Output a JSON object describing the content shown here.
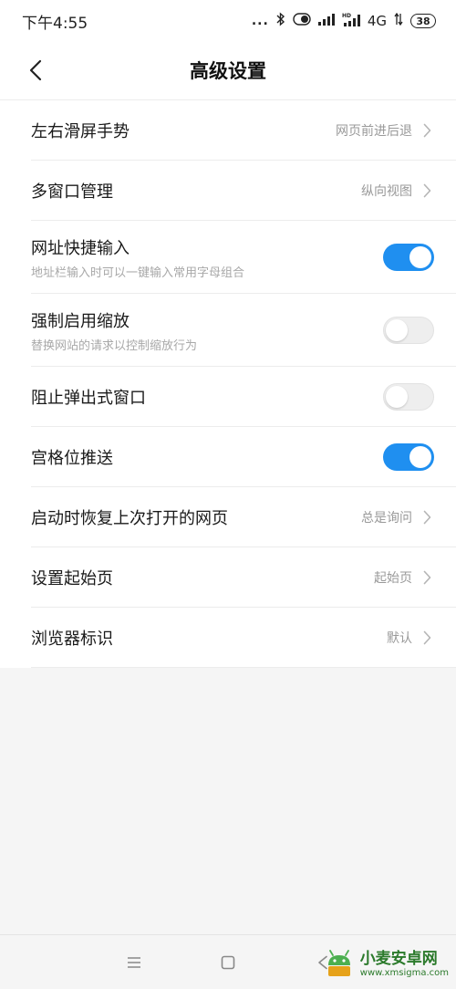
{
  "status_bar": {
    "time": "下午4:55",
    "dots": "...",
    "network": "4G",
    "battery": "38"
  },
  "header": {
    "title": "高级设置"
  },
  "settings": {
    "gesture": {
      "label": "左右滑屏手势",
      "value": "网页前进后退"
    },
    "multi_window": {
      "label": "多窗口管理",
      "value": "纵向视图"
    },
    "url_input": {
      "label": "网址快捷输入",
      "desc": "地址栏输入时可以一键输入常用字母组合",
      "enabled": true
    },
    "force_zoom": {
      "label": "强制启用缩放",
      "desc": "替换网站的请求以控制缩放行为",
      "enabled": false
    },
    "block_popup": {
      "label": "阻止弹出式窗口",
      "enabled": false
    },
    "grid_push": {
      "label": "宫格位推送",
      "enabled": true
    },
    "restore": {
      "label": "启动时恢复上次打开的网页",
      "value": "总是询问"
    },
    "start_page": {
      "label": "设置起始页",
      "value": "起始页"
    },
    "user_agent": {
      "label": "浏览器标识",
      "value": "默认"
    }
  },
  "watermark": {
    "name": "小麦安卓网",
    "url": "www.xmsigma.com"
  },
  "colors": {
    "accent": "#1f8ff0",
    "toggle_off": "#eeeeee",
    "background": "#f5f5f5"
  }
}
